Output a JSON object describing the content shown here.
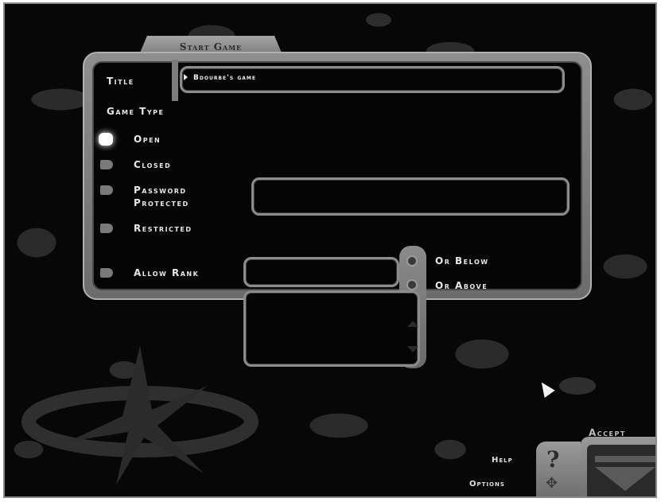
{
  "panel": {
    "tab_label": "Start Game"
  },
  "title_row": {
    "label": "Title",
    "value": "Bdourbe's game"
  },
  "game_type": {
    "label": "Game Type",
    "options": [
      {
        "label": "Open",
        "selected": true
      },
      {
        "label": "Closed",
        "selected": false
      },
      {
        "label": "Password\nProtected",
        "selected": false
      },
      {
        "label": "Restricted",
        "selected": false
      },
      {
        "label": "Allow Rank",
        "selected": false
      }
    ]
  },
  "rank": {
    "or_below": "Or Below",
    "or_above": "Or Above"
  },
  "footer": {
    "help": "Help",
    "options": "Options",
    "accept": "Accept"
  }
}
